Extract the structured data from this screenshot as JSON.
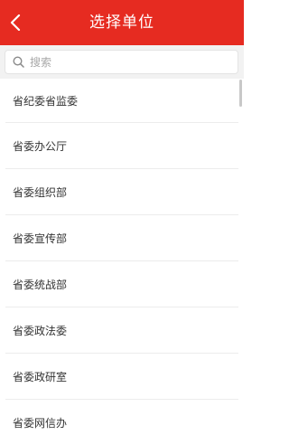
{
  "header": {
    "title": "选择单位",
    "background_color": "#e62b21",
    "back_icon": "chevron-left-icon"
  },
  "search": {
    "placeholder": "搜索",
    "value": "",
    "icon": "search-icon"
  },
  "list": {
    "items": [
      {
        "label": "省纪委省监委"
      },
      {
        "label": "省委办公厅"
      },
      {
        "label": "省委组织部"
      },
      {
        "label": "省委宣传部"
      },
      {
        "label": "省委统战部"
      },
      {
        "label": "省委政法委"
      },
      {
        "label": "省委政研室"
      },
      {
        "label": "省委网信办"
      }
    ]
  }
}
